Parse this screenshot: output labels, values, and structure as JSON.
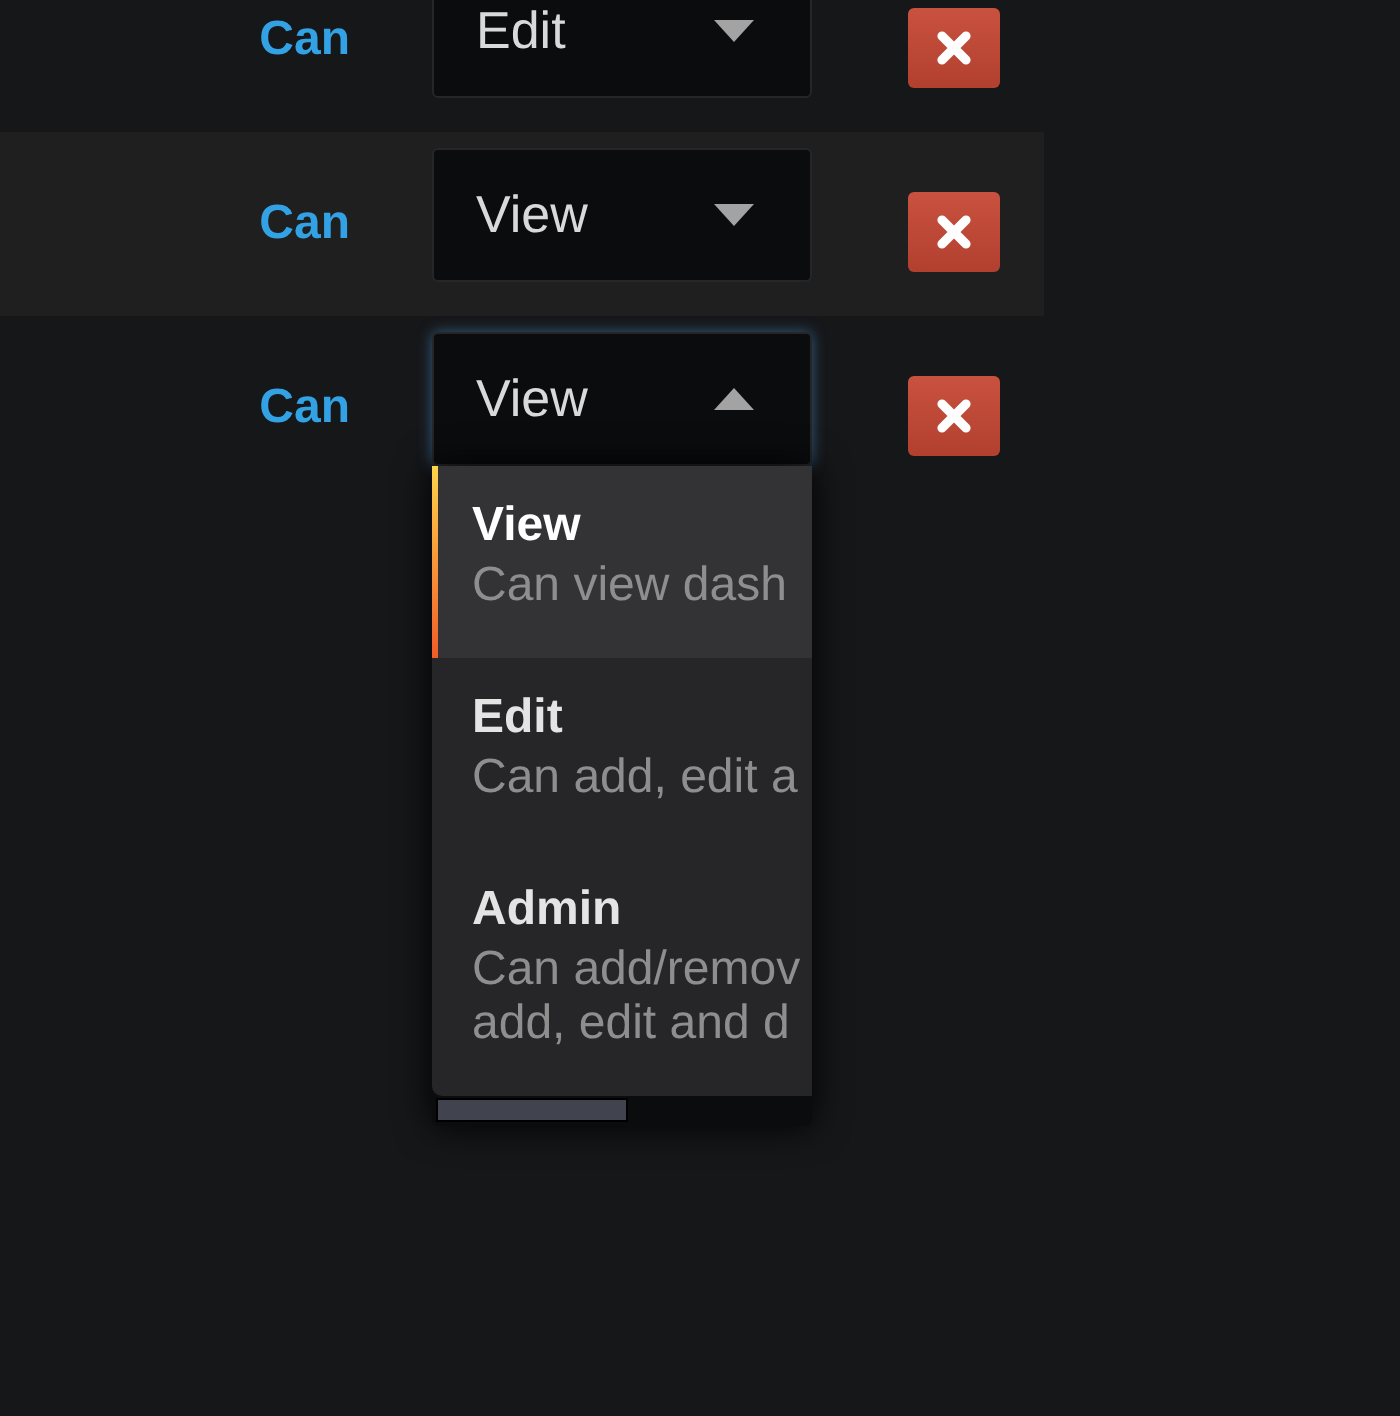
{
  "permissions": [
    {
      "label": "Can",
      "value": "Edit",
      "open": false
    },
    {
      "label": "Can",
      "value": "View",
      "open": false
    },
    {
      "label": "Can",
      "value": "View",
      "open": true,
      "options": [
        {
          "title": "View",
          "description": "Can view dash",
          "selected": true
        },
        {
          "title": "Edit",
          "description": "Can add, edit a",
          "selected": false
        },
        {
          "title": "Admin",
          "description": "Can add/remov\nadd, edit and d",
          "selected": false
        }
      ]
    }
  ]
}
